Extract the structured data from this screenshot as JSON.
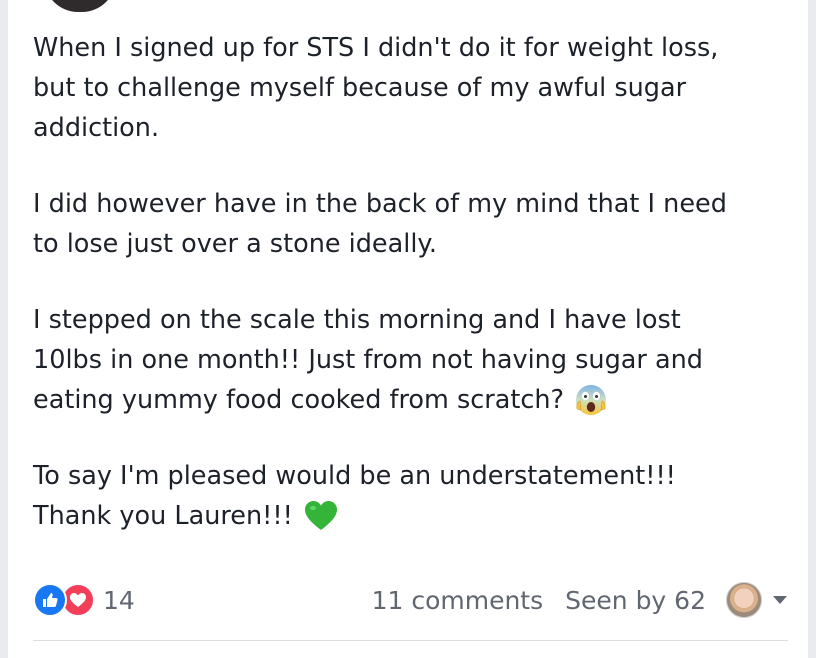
{
  "post": {
    "lines": [
      "When I signed up for STS I didn't do it for weight loss,",
      "but to challenge myself because of my awful sugar",
      "addiction.",
      "I did however have in the back of my mind that I need",
      "to lose just over a stone ideally.",
      "I stepped on the scale this morning and I have lost",
      "10lbs in one month!! Just from not having sugar and",
      "eating yummy food cooked from scratch?",
      "To say I'm pleased would be an understatement!!!",
      "Thank you Lauren!!!"
    ],
    "emojis": [
      "screaming-face",
      "green-heart"
    ]
  },
  "footer": {
    "reaction_count": "14",
    "comments": "11 comments",
    "seen_by": "Seen by 62"
  },
  "colors": {
    "like": "#1877f2",
    "love": "#f33e58",
    "heart_emoji": "#35b43a",
    "text": "#1d2129",
    "meta": "#606770"
  }
}
